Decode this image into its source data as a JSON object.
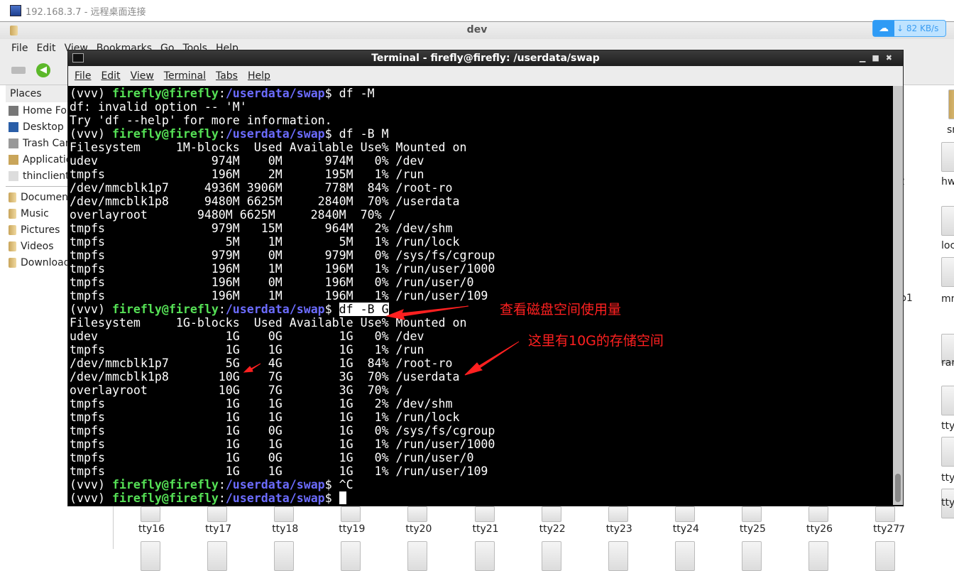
{
  "rdp": {
    "title": "192.168.3.7 - 远程桌面连接"
  },
  "file_manager": {
    "title": "dev",
    "menu": [
      "File",
      "Edit",
      "View",
      "Bookmarks",
      "Go",
      "Tools",
      "Help"
    ],
    "places_header": "Places",
    "places": [
      "Home Folder",
      "Desktop",
      "Trash Can",
      "Applications",
      "thinclient_drives"
    ],
    "bookmarks": [
      "Documents",
      "Music",
      "Pictures",
      "Videos",
      "Downloads"
    ],
    "right_labels": [
      "sn",
      "hw",
      "loc",
      "mmcb",
      "ran",
      "tty",
      "tty",
      "tty"
    ],
    "partial_labels": [
      "2",
      "p1",
      "7"
    ],
    "bottom_files": [
      "tty16",
      "tty17",
      "tty18",
      "tty19",
      "tty20",
      "tty21",
      "tty22",
      "tty23",
      "tty24",
      "tty25",
      "tty26",
      "tty27"
    ]
  },
  "speed": {
    "value": "82 KB/s"
  },
  "terminal": {
    "title": "Terminal - firefly@firefly: /userdata/swap",
    "menu": [
      "File",
      "Edit",
      "View",
      "Terminal",
      "Tabs",
      "Help"
    ],
    "prompt": {
      "env": "(vvv) ",
      "user": "firefly@firefly",
      "sep": ":",
      "path": "/userdata/swap",
      "sign": "$ "
    },
    "lines": [
      {
        "cmd": "df -M"
      },
      {
        "text": "df: invalid option -- 'M'"
      },
      {
        "text": "Try 'df --help' for more information."
      },
      {
        "cmd": "df -B M"
      },
      {
        "text": "Filesystem     1M-blocks  Used Available Use% Mounted on"
      },
      {
        "text": "udev                974M    0M      974M   0% /dev"
      },
      {
        "text": "tmpfs               196M    2M      195M   1% /run"
      },
      {
        "text": "/dev/mmcblk1p7     4936M 3906M      778M  84% /root-ro"
      },
      {
        "text": "/dev/mmcblk1p8     9480M 6625M     2840M  70% /userdata"
      },
      {
        "text": "overlayroot       9480M 6625M     2840M  70% /"
      },
      {
        "text": "tmpfs               979M   15M      964M   2% /dev/shm"
      },
      {
        "text": "tmpfs                 5M    1M        5M   1% /run/lock"
      },
      {
        "text": "tmpfs               979M    0M      979M   0% /sys/fs/cgroup"
      },
      {
        "text": "tmpfs               196M    1M      196M   1% /run/user/1000"
      },
      {
        "text": "tmpfs               196M    0M      196M   0% /run/user/0"
      },
      {
        "text": "tmpfs               196M    1M      196M   1% /run/user/109"
      },
      {
        "cmd": "df -B G",
        "selected": true
      },
      {
        "text": "Filesystem     1G-blocks  Used Available Use% Mounted on"
      },
      {
        "text": "udev                  1G    0G        1G   0% /dev"
      },
      {
        "text": "tmpfs                 1G    1G        1G   1% /run"
      },
      {
        "text": "/dev/mmcblk1p7        5G    4G        1G  84% /root-ro"
      },
      {
        "text": "/dev/mmcblk1p8       10G    7G        3G  70% /userdata"
      },
      {
        "text": "overlayroot          10G    7G        3G  70% /"
      },
      {
        "text": "tmpfs                 1G    1G        1G   2% /dev/shm"
      },
      {
        "text": "tmpfs                 1G    1G        1G   1% /run/lock"
      },
      {
        "text": "tmpfs                 1G    0G        1G   0% /sys/fs/cgroup"
      },
      {
        "text": "tmpfs                 1G    1G        1G   1% /run/user/1000"
      },
      {
        "text": "tmpfs                 1G    0G        1G   0% /run/user/0"
      },
      {
        "text": "tmpfs                 1G    1G        1G   1% /run/user/109"
      },
      {
        "cmd": "^C"
      },
      {
        "cmd": "",
        "cursor": true
      }
    ]
  },
  "annotations": {
    "check_disk": "查看磁盘空间使用量",
    "storage_10g": "这里有10G的存储空间",
    "color": "#ff2020"
  }
}
